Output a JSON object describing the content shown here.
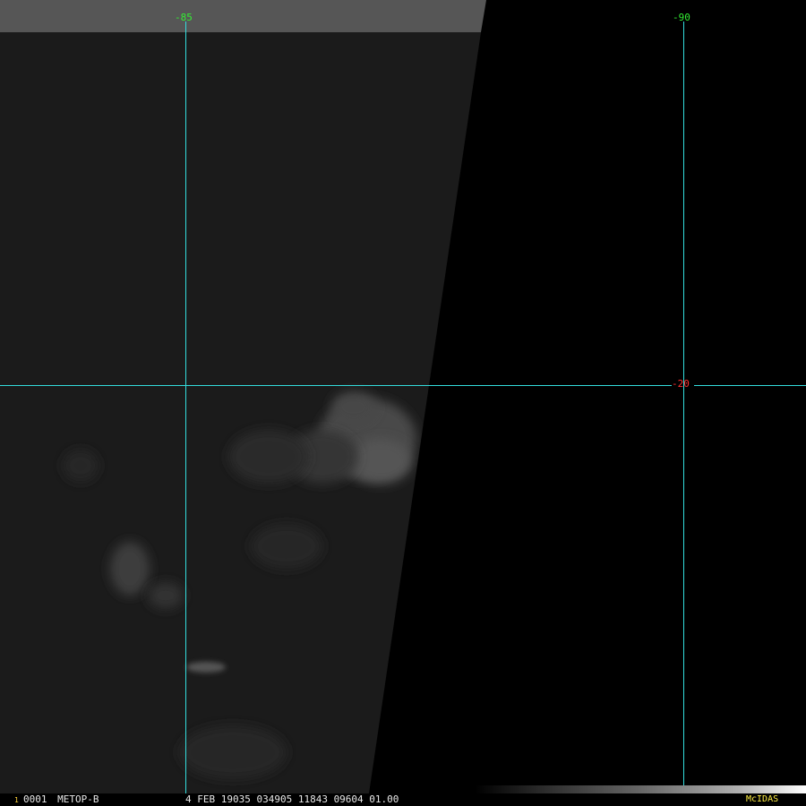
{
  "imagery": {
    "colors": {
      "swath_top_strip": "#565656",
      "swath_body": "#1b1b1b",
      "space_background": "#000000",
      "cloud": "#4a4a4a",
      "grid_line": "#33dddd"
    }
  },
  "grid": {
    "longitude_labels": [
      "-85",
      "-90"
    ],
    "latitude_labels": [
      "-20"
    ],
    "longitude_label_color": "#33ee33",
    "latitude_label_color": "#ff3030"
  },
  "status": {
    "frame_marker": "1",
    "frame_number": "0001",
    "satellite": "METOP-B",
    "timestamp_line": "4 FEB 19035 034905 11843 09604 01.00",
    "brand": "McIDAS"
  }
}
